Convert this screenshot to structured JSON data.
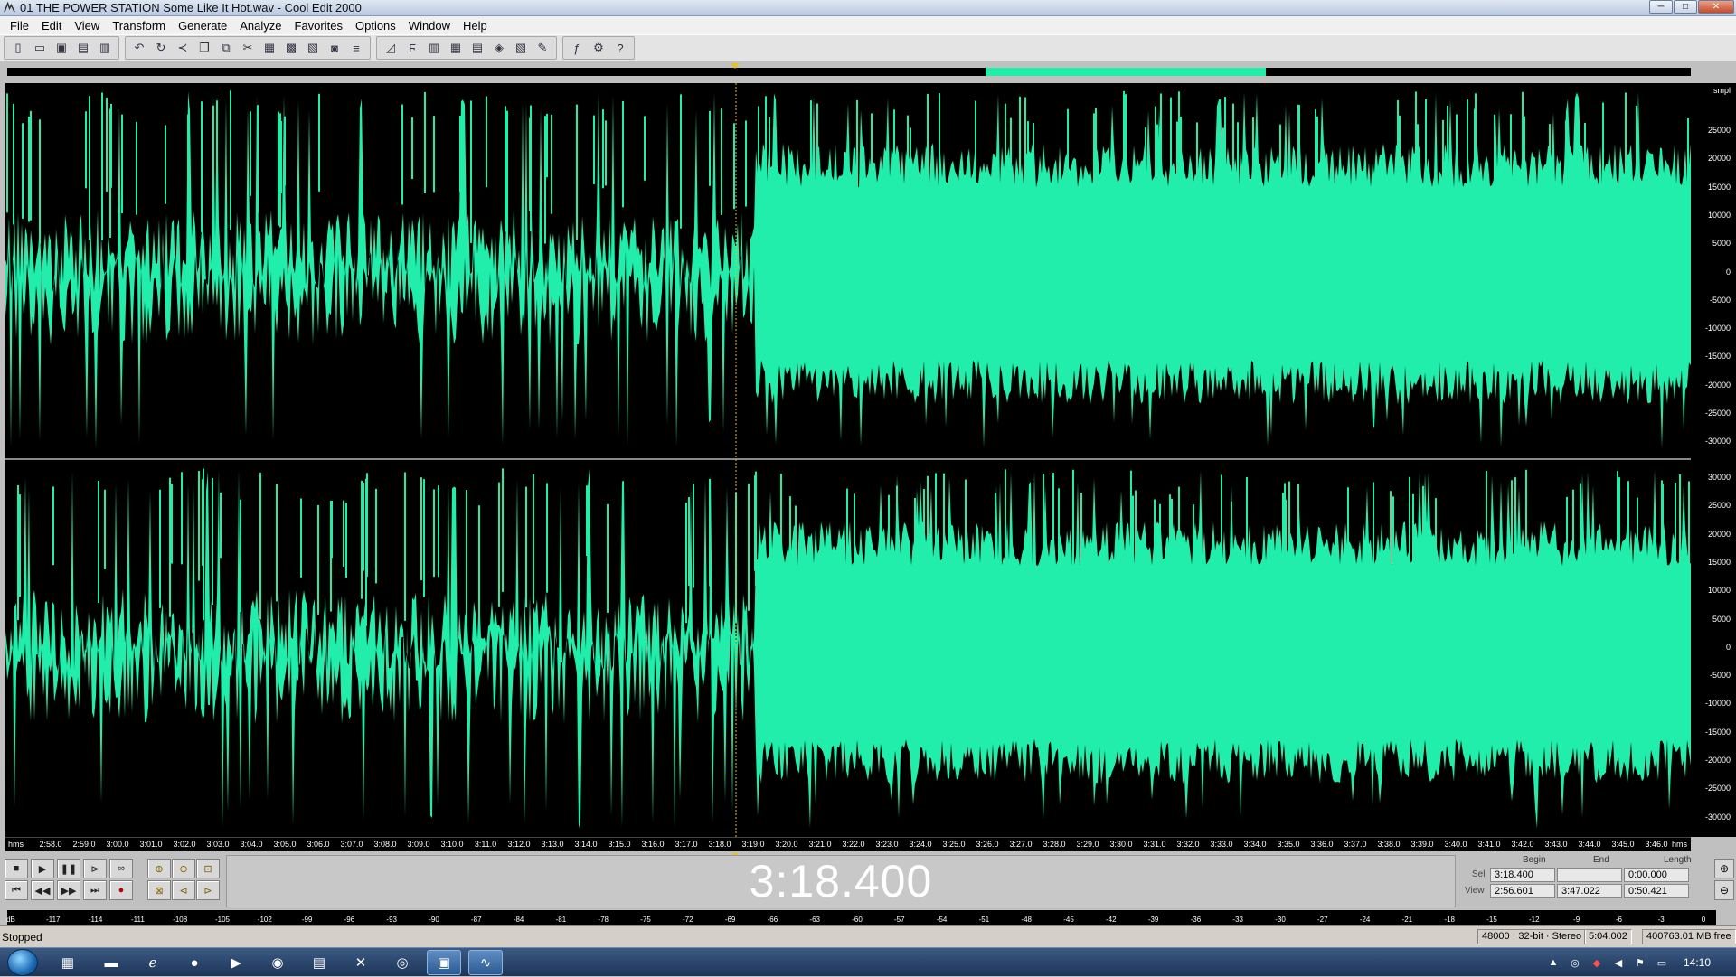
{
  "window": {
    "title": "01 THE POWER STATION Some Like It Hot.wav - Cool Edit 2000",
    "minimize": "─",
    "maximize": "□",
    "close": "✕"
  },
  "menu": [
    "File",
    "Edit",
    "View",
    "Transform",
    "Generate",
    "Analyze",
    "Favorites",
    "Options",
    "Window",
    "Help"
  ],
  "toolbar_icons": [
    [
      "new-file-icon",
      "open-folder-icon",
      "save-icon",
      "save-as-icon",
      "close-file-icon"
    ],
    [
      "undo-icon",
      "repeat-icon",
      "trim-icon",
      "copy-icon",
      "copy-to-new-icon",
      "cut-icon",
      "paste-icon",
      "paste-to-new-icon",
      "mix-paste-icon",
      "cd-player-icon",
      "cue-list-icon"
    ],
    [
      "envelope-icon",
      "filter-icon",
      "graphic-eq-icon",
      "spectrum-icon",
      "noise-reduction-icon",
      "frequency-analysis-icon",
      "statistics-icon",
      "scripts-icon"
    ],
    [
      "fx-icon",
      "settings-icon",
      "help-icon"
    ]
  ],
  "waveform": {
    "wave_color": "#20eeaa",
    "background_color": "#000000",
    "cursor_time": "3:18.400"
  },
  "amplitude_axis": {
    "unit": "smpl",
    "top_channel": [
      "25000",
      "20000",
      "15000",
      "10000",
      "5000",
      "0",
      "-5000",
      "-10000",
      "-15000",
      "-20000",
      "-25000",
      "-30000"
    ],
    "bottom_channel": [
      "30000",
      "25000",
      "20000",
      "15000",
      "10000",
      "5000",
      "0",
      "-5000",
      "-10000",
      "-15000",
      "-20000",
      "-25000",
      "-30000"
    ]
  },
  "time_ruler": {
    "unit_left": "hms",
    "unit_right": "hms",
    "ticks": [
      "2:58.0",
      "2:59.0",
      "3:00.0",
      "3:01.0",
      "3:02.0",
      "3:03.0",
      "3:04.0",
      "3:05.0",
      "3:06.0",
      "3:07.0",
      "3:08.0",
      "3:09.0",
      "3:10.0",
      "3:11.0",
      "3:12.0",
      "3:13.0",
      "3:14.0",
      "3:15.0",
      "3:16.0",
      "3:17.0",
      "3:18.0",
      "3:19.0",
      "3:20.0",
      "3:21.0",
      "3:22.0",
      "3:23.0",
      "3:24.0",
      "3:25.0",
      "3:26.0",
      "3:27.0",
      "3:28.0",
      "3:29.0",
      "3:30.0",
      "3:31.0",
      "3:32.0",
      "3:33.0",
      "3:34.0",
      "3:35.0",
      "3:36.0",
      "3:37.0",
      "3:38.0",
      "3:39.0",
      "3:40.0",
      "3:41.0",
      "3:42.0",
      "3:43.0",
      "3:44.0",
      "3:45.0",
      "3:46.0"
    ]
  },
  "transport": {
    "time_display": "3:18.400",
    "row1": [
      "stop-icon",
      "play-icon",
      "pause-icon",
      "play-to-end-icon",
      "loop-icon"
    ],
    "row2": [
      "go-to-start-icon",
      "rewind-icon",
      "fast-forward-icon",
      "go-to-end-icon",
      "record-icon"
    ],
    "zoom_row1": [
      "zoom-in-horizontal-icon",
      "zoom-out-horizontal-icon",
      "zoom-full-icon"
    ],
    "zoom_row2": [
      "zoom-selection-icon",
      "zoom-left-icon",
      "zoom-right-icon"
    ]
  },
  "selection": {
    "headers": [
      "Begin",
      "End",
      "Length"
    ],
    "sel_label": "Sel",
    "view_label": "View",
    "sel": [
      "3:18.400",
      "",
      "0:00.000"
    ],
    "view": [
      "2:56.601",
      "3:47.022",
      "0:50.421"
    ]
  },
  "level_meter": {
    "labels": [
      "dB",
      "-117",
      "-114",
      "-111",
      "-108",
      "-105",
      "-102",
      "-99",
      "-96",
      "-93",
      "-90",
      "-87",
      "-84",
      "-81",
      "-78",
      "-75",
      "-72",
      "-69",
      "-66",
      "-63",
      "-60",
      "-57",
      "-54",
      "-51",
      "-48",
      "-45",
      "-42",
      "-39",
      "-36",
      "-33",
      "-30",
      "-27",
      "-24",
      "-21",
      "-18",
      "-15",
      "-12",
      "-9",
      "-6",
      "-3",
      "0"
    ]
  },
  "status": {
    "state": "Stopped",
    "format": "48000 · 32-bit · Stereo",
    "duration": "5:04.002",
    "free_space": "400763.01 MB free"
  },
  "taskbar": {
    "clock": "14:10"
  }
}
